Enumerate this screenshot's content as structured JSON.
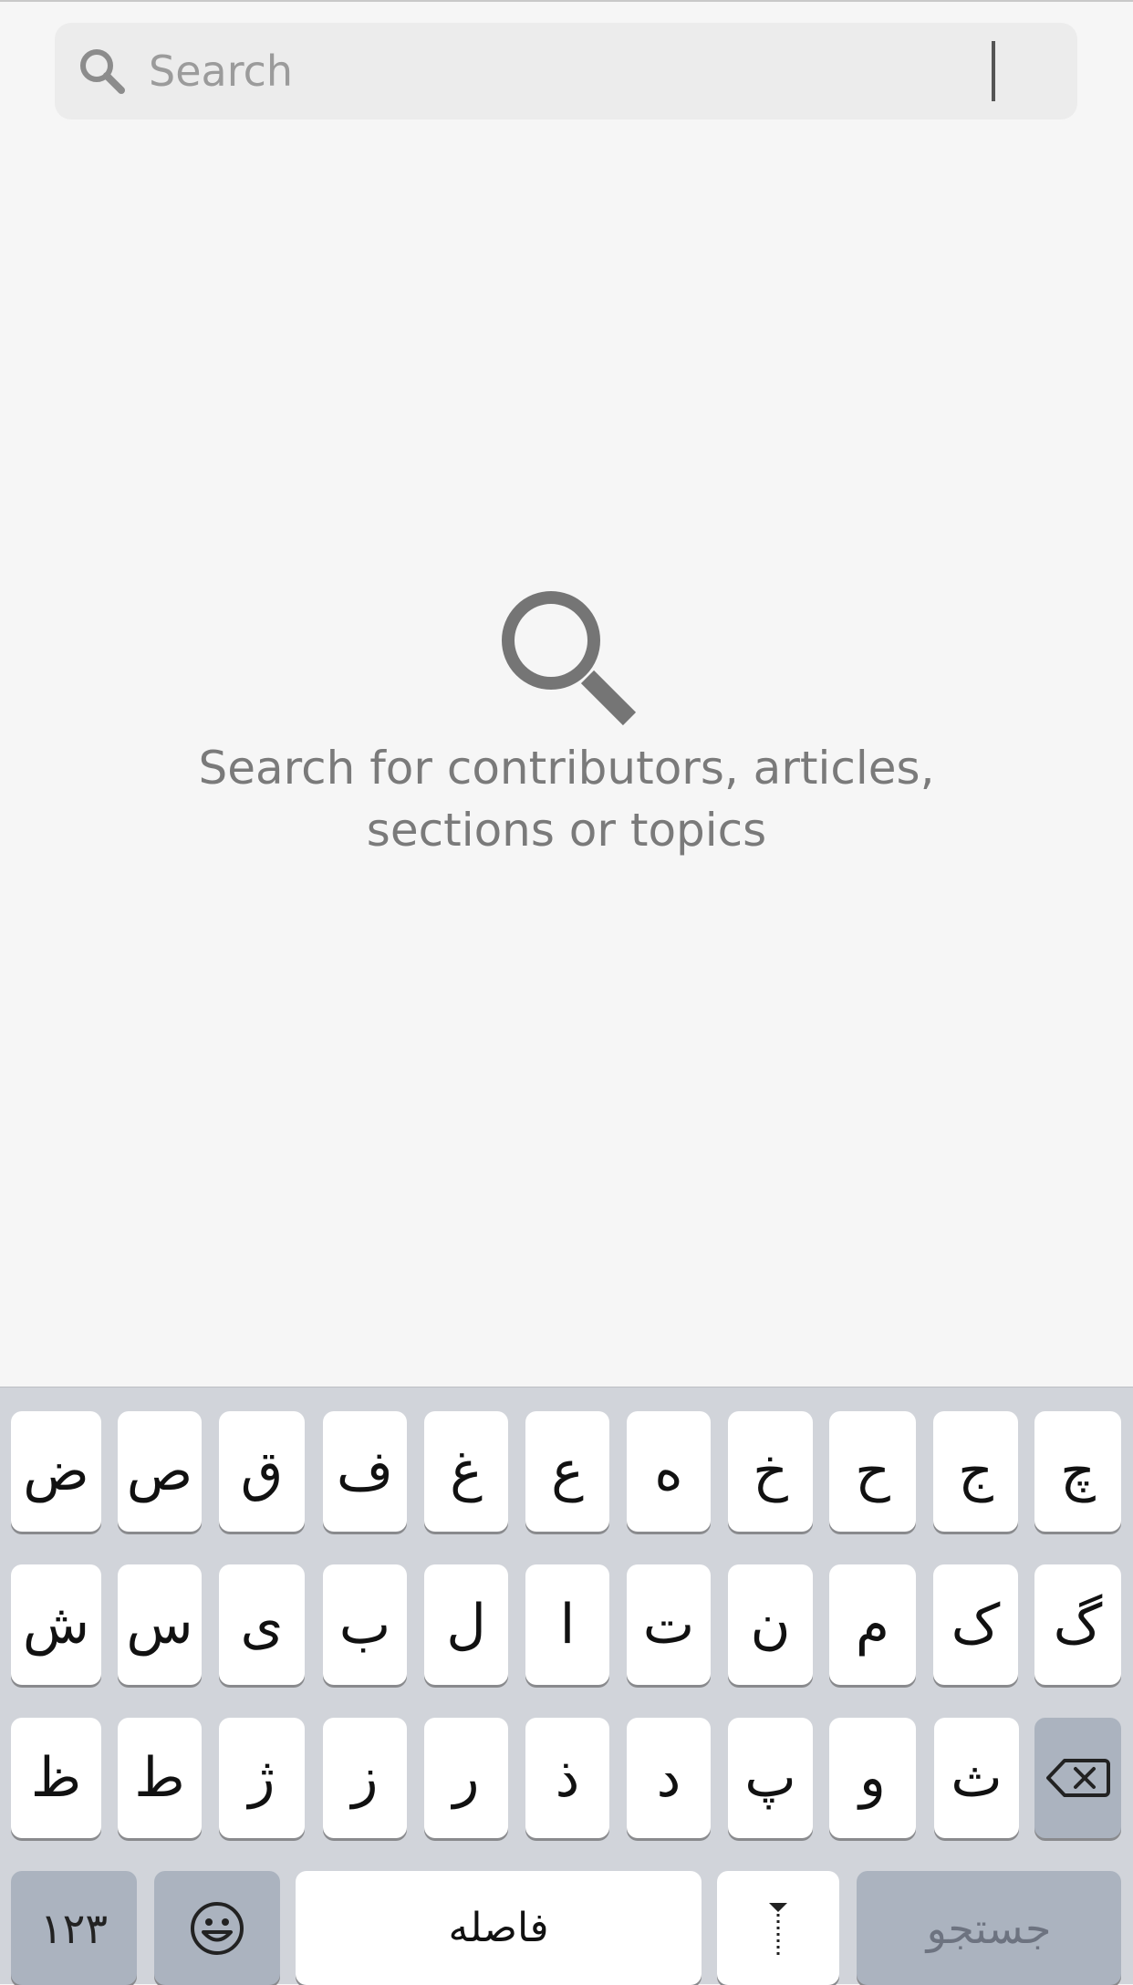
{
  "search": {
    "placeholder": "Search",
    "value": ""
  },
  "empty_state": {
    "icon": "search-icon",
    "message_line1": "Search for contributors, articles,",
    "message_line2": "sections or topics"
  },
  "keyboard": {
    "row1": [
      "ض",
      "ص",
      "ق",
      "ف",
      "غ",
      "ع",
      "ه",
      "خ",
      "ح",
      "ج",
      "چ"
    ],
    "row2": [
      "ش",
      "س",
      "ی",
      "ب",
      "ل",
      "ا",
      "ت",
      "ن",
      "م",
      "ک",
      "گ"
    ],
    "row3": [
      "ظ",
      "ط",
      "ژ",
      "ز",
      "ر",
      "ذ",
      "د",
      "پ",
      "و",
      "ث"
    ],
    "backspace_icon": "backspace-icon",
    "numbers_label": "۱۲۳",
    "emoji_icon": "emoji-icon",
    "space_label": "فاصله",
    "zwnj_icon": "zwnj-icon",
    "go_label": "جستجو"
  }
}
